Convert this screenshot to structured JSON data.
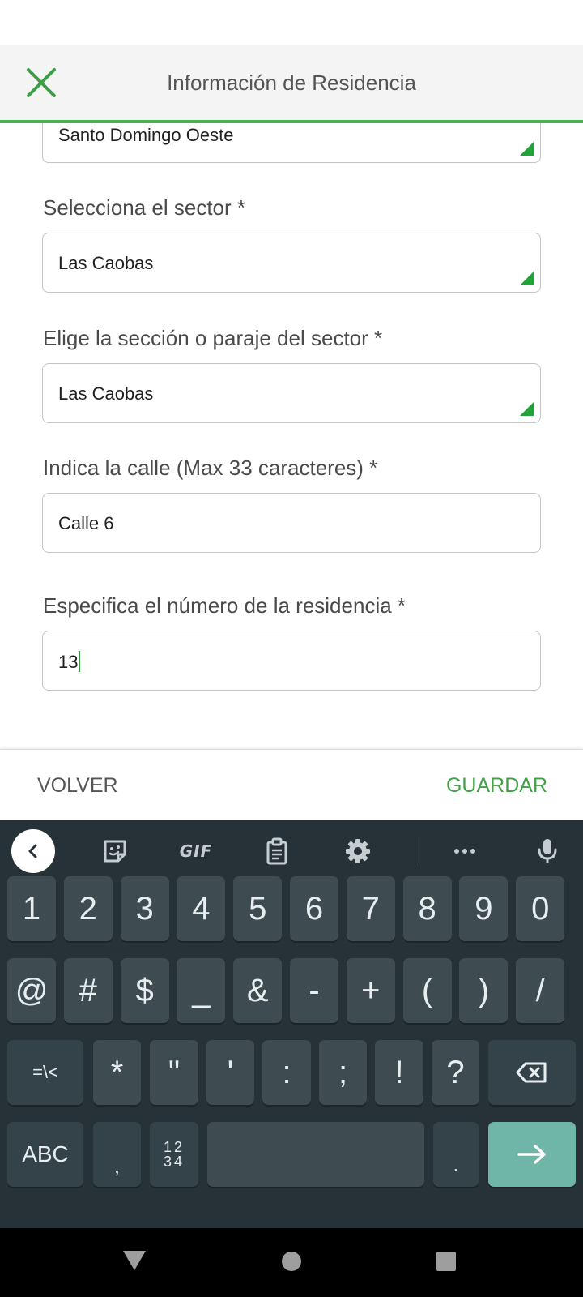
{
  "app_bar": {
    "title": "Información de Residencia",
    "close_icon": "close-icon",
    "accent": "#4caf50"
  },
  "form": {
    "municipality": {
      "value": "Santo Domingo Oeste"
    },
    "sector": {
      "label": "Selecciona el sector *",
      "value": "Las Caobas"
    },
    "section": {
      "label": "Elige la sección o paraje del sector *",
      "value": "Las Caobas"
    },
    "street": {
      "label": "Indica la calle (Max 33 caracteres) *",
      "value": "Calle 6"
    },
    "number": {
      "label": "Especifica el número de la residencia *",
      "value": "13"
    }
  },
  "actions": {
    "back_label": "VOLVER",
    "save_label": "GUARDAR",
    "save_color": "#43a047"
  },
  "keyboard": {
    "toolbar": {
      "gif_label": "GIF",
      "icons": [
        "chevron-left-icon",
        "sticker-icon",
        "gif-icon",
        "clipboard-icon",
        "gear-icon",
        "more-icon",
        "mic-icon"
      ]
    },
    "row1": [
      "1",
      "2",
      "3",
      "4",
      "5",
      "6",
      "7",
      "8",
      "9",
      "0"
    ],
    "row2": [
      "@",
      "#",
      "$",
      "_",
      "&",
      "-",
      "+",
      "(",
      ")",
      "/"
    ],
    "row3": [
      "=\\<",
      "*",
      "\"",
      "'",
      ":",
      ";",
      "!",
      "?"
    ],
    "row4": {
      "abc": "ABC",
      "comma": ",",
      "numpad_top": "12",
      "numpad_bottom": "34",
      "period": "."
    },
    "action_color": "#6fb5a8"
  },
  "nav_bar": {
    "icons": [
      "back-triangle-icon",
      "home-circle-icon",
      "recents-square-icon"
    ]
  }
}
